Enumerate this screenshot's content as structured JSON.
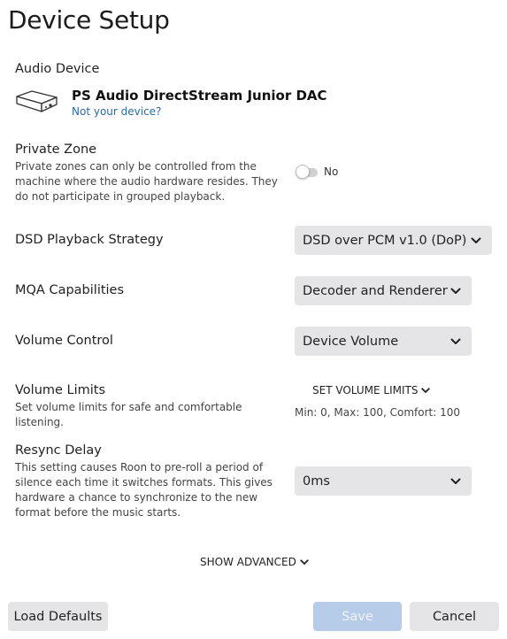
{
  "page": {
    "title": "Device Setup"
  },
  "audio_device": {
    "label": "Audio Device",
    "name": "PS Audio DirectStream Junior DAC",
    "link": "Not your device?",
    "icon": "dac-device-icon"
  },
  "private_zone": {
    "label": "Private Zone",
    "description": "Private zones can only be controlled from the machine where the audio hardware resides. They do not participate in grouped playback.",
    "toggle_on": false,
    "toggle_text": "No"
  },
  "dsd": {
    "label": "DSD Playback Strategy",
    "value": "DSD over PCM v1.0 (DoP)"
  },
  "mqa": {
    "label": "MQA Capabilities",
    "value": "Decoder and Renderer"
  },
  "volume_control": {
    "label": "Volume Control",
    "value": "Device Volume"
  },
  "volume_limits": {
    "label": "Volume Limits",
    "description": "Set volume limits for safe and comfortable listening.",
    "button": "SET VOLUME LIMITS",
    "summary": "Min: 0, Max: 100, Comfort: 100"
  },
  "resync": {
    "label": "Resync Delay",
    "description": "This setting causes Roon to pre-roll a period of silence each time it switches formats. This gives hardware a chance to synchronize to the new format before the music starts.",
    "value": "0ms"
  },
  "advanced": {
    "label": "SHOW ADVANCED"
  },
  "footer": {
    "load_defaults": "Load Defaults",
    "save": "Save",
    "cancel": "Cancel"
  },
  "colors": {
    "select_bg": "#e5e5e8",
    "link": "#2a6ab0",
    "save_disabled": "#b6cce9"
  }
}
